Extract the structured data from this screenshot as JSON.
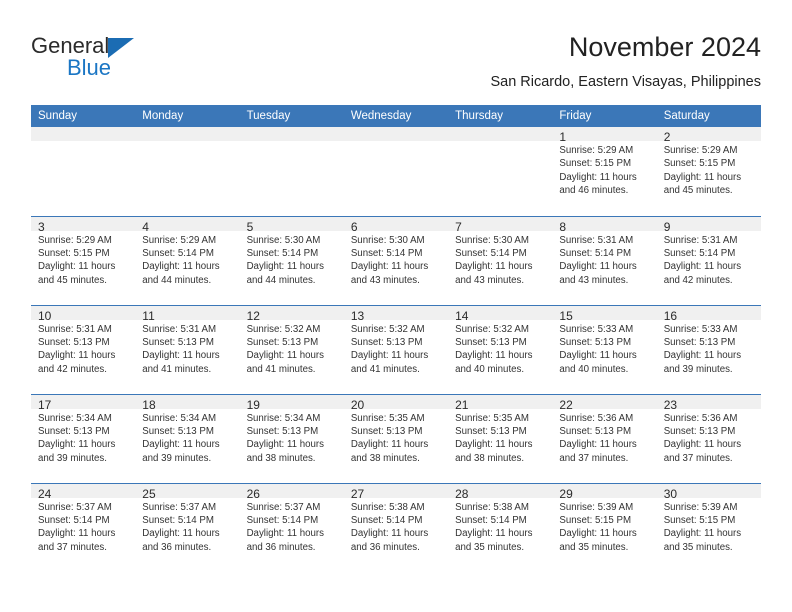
{
  "logo": {
    "word_one": "General",
    "word_two": "Blue",
    "triangle_icon": "triangle-icon"
  },
  "header": {
    "title": "November 2024",
    "subtitle": "San Ricardo, Eastern Visayas, Philippines"
  },
  "colors": {
    "header_blue": "#3b77b8",
    "daynum_band": "#f0f0f0",
    "logo_blue": "#1b76c4",
    "text": "#333333"
  },
  "calendar": {
    "weekday_headers": [
      "Sunday",
      "Monday",
      "Tuesday",
      "Wednesday",
      "Thursday",
      "Friday",
      "Saturday"
    ],
    "labels": {
      "sunrise": "Sunrise:",
      "sunset": "Sunset:",
      "daylight": "Daylight:"
    },
    "weeks": [
      [
        {
          "day": "",
          "sunrise": "",
          "sunset": "",
          "daylight_line1": "",
          "daylight_line2": ""
        },
        {
          "day": "",
          "sunrise": "",
          "sunset": "",
          "daylight_line1": "",
          "daylight_line2": ""
        },
        {
          "day": "",
          "sunrise": "",
          "sunset": "",
          "daylight_line1": "",
          "daylight_line2": ""
        },
        {
          "day": "",
          "sunrise": "",
          "sunset": "",
          "daylight_line1": "",
          "daylight_line2": ""
        },
        {
          "day": "",
          "sunrise": "",
          "sunset": "",
          "daylight_line1": "",
          "daylight_line2": ""
        },
        {
          "day": "1",
          "sunrise": "Sunrise: 5:29 AM",
          "sunset": "Sunset: 5:15 PM",
          "daylight_line1": "Daylight: 11 hours",
          "daylight_line2": "and 46 minutes."
        },
        {
          "day": "2",
          "sunrise": "Sunrise: 5:29 AM",
          "sunset": "Sunset: 5:15 PM",
          "daylight_line1": "Daylight: 11 hours",
          "daylight_line2": "and 45 minutes."
        }
      ],
      [
        {
          "day": "3",
          "sunrise": "Sunrise: 5:29 AM",
          "sunset": "Sunset: 5:15 PM",
          "daylight_line1": "Daylight: 11 hours",
          "daylight_line2": "and 45 minutes."
        },
        {
          "day": "4",
          "sunrise": "Sunrise: 5:29 AM",
          "sunset": "Sunset: 5:14 PM",
          "daylight_line1": "Daylight: 11 hours",
          "daylight_line2": "and 44 minutes."
        },
        {
          "day": "5",
          "sunrise": "Sunrise: 5:30 AM",
          "sunset": "Sunset: 5:14 PM",
          "daylight_line1": "Daylight: 11 hours",
          "daylight_line2": "and 44 minutes."
        },
        {
          "day": "6",
          "sunrise": "Sunrise: 5:30 AM",
          "sunset": "Sunset: 5:14 PM",
          "daylight_line1": "Daylight: 11 hours",
          "daylight_line2": "and 43 minutes."
        },
        {
          "day": "7",
          "sunrise": "Sunrise: 5:30 AM",
          "sunset": "Sunset: 5:14 PM",
          "daylight_line1": "Daylight: 11 hours",
          "daylight_line2": "and 43 minutes."
        },
        {
          "day": "8",
          "sunrise": "Sunrise: 5:31 AM",
          "sunset": "Sunset: 5:14 PM",
          "daylight_line1": "Daylight: 11 hours",
          "daylight_line2": "and 43 minutes."
        },
        {
          "day": "9",
          "sunrise": "Sunrise: 5:31 AM",
          "sunset": "Sunset: 5:14 PM",
          "daylight_line1": "Daylight: 11 hours",
          "daylight_line2": "and 42 minutes."
        }
      ],
      [
        {
          "day": "10",
          "sunrise": "Sunrise: 5:31 AM",
          "sunset": "Sunset: 5:13 PM",
          "daylight_line1": "Daylight: 11 hours",
          "daylight_line2": "and 42 minutes."
        },
        {
          "day": "11",
          "sunrise": "Sunrise: 5:31 AM",
          "sunset": "Sunset: 5:13 PM",
          "daylight_line1": "Daylight: 11 hours",
          "daylight_line2": "and 41 minutes."
        },
        {
          "day": "12",
          "sunrise": "Sunrise: 5:32 AM",
          "sunset": "Sunset: 5:13 PM",
          "daylight_line1": "Daylight: 11 hours",
          "daylight_line2": "and 41 minutes."
        },
        {
          "day": "13",
          "sunrise": "Sunrise: 5:32 AM",
          "sunset": "Sunset: 5:13 PM",
          "daylight_line1": "Daylight: 11 hours",
          "daylight_line2": "and 41 minutes."
        },
        {
          "day": "14",
          "sunrise": "Sunrise: 5:32 AM",
          "sunset": "Sunset: 5:13 PM",
          "daylight_line1": "Daylight: 11 hours",
          "daylight_line2": "and 40 minutes."
        },
        {
          "day": "15",
          "sunrise": "Sunrise: 5:33 AM",
          "sunset": "Sunset: 5:13 PM",
          "daylight_line1": "Daylight: 11 hours",
          "daylight_line2": "and 40 minutes."
        },
        {
          "day": "16",
          "sunrise": "Sunrise: 5:33 AM",
          "sunset": "Sunset: 5:13 PM",
          "daylight_line1": "Daylight: 11 hours",
          "daylight_line2": "and 39 minutes."
        }
      ],
      [
        {
          "day": "17",
          "sunrise": "Sunrise: 5:34 AM",
          "sunset": "Sunset: 5:13 PM",
          "daylight_line1": "Daylight: 11 hours",
          "daylight_line2": "and 39 minutes."
        },
        {
          "day": "18",
          "sunrise": "Sunrise: 5:34 AM",
          "sunset": "Sunset: 5:13 PM",
          "daylight_line1": "Daylight: 11 hours",
          "daylight_line2": "and 39 minutes."
        },
        {
          "day": "19",
          "sunrise": "Sunrise: 5:34 AM",
          "sunset": "Sunset: 5:13 PM",
          "daylight_line1": "Daylight: 11 hours",
          "daylight_line2": "and 38 minutes."
        },
        {
          "day": "20",
          "sunrise": "Sunrise: 5:35 AM",
          "sunset": "Sunset: 5:13 PM",
          "daylight_line1": "Daylight: 11 hours",
          "daylight_line2": "and 38 minutes."
        },
        {
          "day": "21",
          "sunrise": "Sunrise: 5:35 AM",
          "sunset": "Sunset: 5:13 PM",
          "daylight_line1": "Daylight: 11 hours",
          "daylight_line2": "and 38 minutes."
        },
        {
          "day": "22",
          "sunrise": "Sunrise: 5:36 AM",
          "sunset": "Sunset: 5:13 PM",
          "daylight_line1": "Daylight: 11 hours",
          "daylight_line2": "and 37 minutes."
        },
        {
          "day": "23",
          "sunrise": "Sunrise: 5:36 AM",
          "sunset": "Sunset: 5:13 PM",
          "daylight_line1": "Daylight: 11 hours",
          "daylight_line2": "and 37 minutes."
        }
      ],
      [
        {
          "day": "24",
          "sunrise": "Sunrise: 5:37 AM",
          "sunset": "Sunset: 5:14 PM",
          "daylight_line1": "Daylight: 11 hours",
          "daylight_line2": "and 37 minutes."
        },
        {
          "day": "25",
          "sunrise": "Sunrise: 5:37 AM",
          "sunset": "Sunset: 5:14 PM",
          "daylight_line1": "Daylight: 11 hours",
          "daylight_line2": "and 36 minutes."
        },
        {
          "day": "26",
          "sunrise": "Sunrise: 5:37 AM",
          "sunset": "Sunset: 5:14 PM",
          "daylight_line1": "Daylight: 11 hours",
          "daylight_line2": "and 36 minutes."
        },
        {
          "day": "27",
          "sunrise": "Sunrise: 5:38 AM",
          "sunset": "Sunset: 5:14 PM",
          "daylight_line1": "Daylight: 11 hours",
          "daylight_line2": "and 36 minutes."
        },
        {
          "day": "28",
          "sunrise": "Sunrise: 5:38 AM",
          "sunset": "Sunset: 5:14 PM",
          "daylight_line1": "Daylight: 11 hours",
          "daylight_line2": "and 35 minutes."
        },
        {
          "day": "29",
          "sunrise": "Sunrise: 5:39 AM",
          "sunset": "Sunset: 5:15 PM",
          "daylight_line1": "Daylight: 11 hours",
          "daylight_line2": "and 35 minutes."
        },
        {
          "day": "30",
          "sunrise": "Sunrise: 5:39 AM",
          "sunset": "Sunset: 5:15 PM",
          "daylight_line1": "Daylight: 11 hours",
          "daylight_line2": "and 35 minutes."
        }
      ]
    ]
  }
}
